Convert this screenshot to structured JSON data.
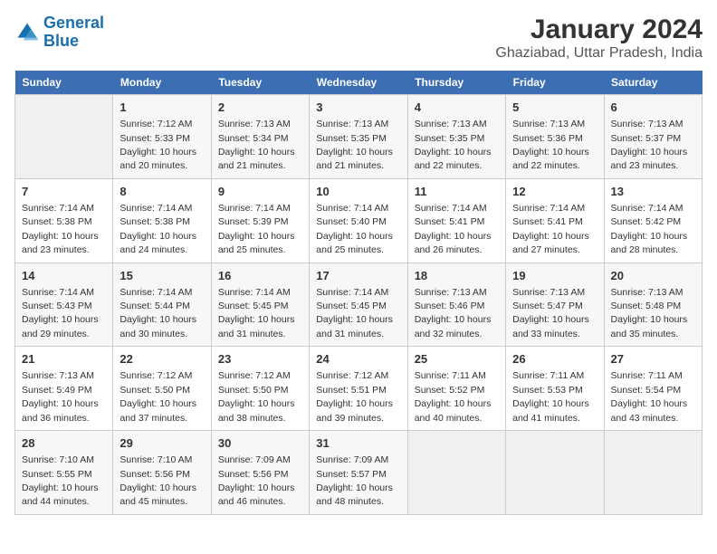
{
  "app": {
    "logo_line1": "General",
    "logo_line2": "Blue",
    "title": "January 2024",
    "subtitle": "Ghaziabad, Uttar Pradesh, India"
  },
  "calendar": {
    "headers": [
      "Sunday",
      "Monday",
      "Tuesday",
      "Wednesday",
      "Thursday",
      "Friday",
      "Saturday"
    ],
    "weeks": [
      [
        {
          "day": "",
          "info": ""
        },
        {
          "day": "1",
          "info": "Sunrise: 7:12 AM\nSunset: 5:33 PM\nDaylight: 10 hours\nand 20 minutes."
        },
        {
          "day": "2",
          "info": "Sunrise: 7:13 AM\nSunset: 5:34 PM\nDaylight: 10 hours\nand 21 minutes."
        },
        {
          "day": "3",
          "info": "Sunrise: 7:13 AM\nSunset: 5:35 PM\nDaylight: 10 hours\nand 21 minutes."
        },
        {
          "day": "4",
          "info": "Sunrise: 7:13 AM\nSunset: 5:35 PM\nDaylight: 10 hours\nand 22 minutes."
        },
        {
          "day": "5",
          "info": "Sunrise: 7:13 AM\nSunset: 5:36 PM\nDaylight: 10 hours\nand 22 minutes."
        },
        {
          "day": "6",
          "info": "Sunrise: 7:13 AM\nSunset: 5:37 PM\nDaylight: 10 hours\nand 23 minutes."
        }
      ],
      [
        {
          "day": "7",
          "info": "Sunrise: 7:14 AM\nSunset: 5:38 PM\nDaylight: 10 hours\nand 23 minutes."
        },
        {
          "day": "8",
          "info": "Sunrise: 7:14 AM\nSunset: 5:38 PM\nDaylight: 10 hours\nand 24 minutes."
        },
        {
          "day": "9",
          "info": "Sunrise: 7:14 AM\nSunset: 5:39 PM\nDaylight: 10 hours\nand 25 minutes."
        },
        {
          "day": "10",
          "info": "Sunrise: 7:14 AM\nSunset: 5:40 PM\nDaylight: 10 hours\nand 25 minutes."
        },
        {
          "day": "11",
          "info": "Sunrise: 7:14 AM\nSunset: 5:41 PM\nDaylight: 10 hours\nand 26 minutes."
        },
        {
          "day": "12",
          "info": "Sunrise: 7:14 AM\nSunset: 5:41 PM\nDaylight: 10 hours\nand 27 minutes."
        },
        {
          "day": "13",
          "info": "Sunrise: 7:14 AM\nSunset: 5:42 PM\nDaylight: 10 hours\nand 28 minutes."
        }
      ],
      [
        {
          "day": "14",
          "info": "Sunrise: 7:14 AM\nSunset: 5:43 PM\nDaylight: 10 hours\nand 29 minutes."
        },
        {
          "day": "15",
          "info": "Sunrise: 7:14 AM\nSunset: 5:44 PM\nDaylight: 10 hours\nand 30 minutes."
        },
        {
          "day": "16",
          "info": "Sunrise: 7:14 AM\nSunset: 5:45 PM\nDaylight: 10 hours\nand 31 minutes."
        },
        {
          "day": "17",
          "info": "Sunrise: 7:14 AM\nSunset: 5:45 PM\nDaylight: 10 hours\nand 31 minutes."
        },
        {
          "day": "18",
          "info": "Sunrise: 7:13 AM\nSunset: 5:46 PM\nDaylight: 10 hours\nand 32 minutes."
        },
        {
          "day": "19",
          "info": "Sunrise: 7:13 AM\nSunset: 5:47 PM\nDaylight: 10 hours\nand 33 minutes."
        },
        {
          "day": "20",
          "info": "Sunrise: 7:13 AM\nSunset: 5:48 PM\nDaylight: 10 hours\nand 35 minutes."
        }
      ],
      [
        {
          "day": "21",
          "info": "Sunrise: 7:13 AM\nSunset: 5:49 PM\nDaylight: 10 hours\nand 36 minutes."
        },
        {
          "day": "22",
          "info": "Sunrise: 7:12 AM\nSunset: 5:50 PM\nDaylight: 10 hours\nand 37 minutes."
        },
        {
          "day": "23",
          "info": "Sunrise: 7:12 AM\nSunset: 5:50 PM\nDaylight: 10 hours\nand 38 minutes."
        },
        {
          "day": "24",
          "info": "Sunrise: 7:12 AM\nSunset: 5:51 PM\nDaylight: 10 hours\nand 39 minutes."
        },
        {
          "day": "25",
          "info": "Sunrise: 7:11 AM\nSunset: 5:52 PM\nDaylight: 10 hours\nand 40 minutes."
        },
        {
          "day": "26",
          "info": "Sunrise: 7:11 AM\nSunset: 5:53 PM\nDaylight: 10 hours\nand 41 minutes."
        },
        {
          "day": "27",
          "info": "Sunrise: 7:11 AM\nSunset: 5:54 PM\nDaylight: 10 hours\nand 43 minutes."
        }
      ],
      [
        {
          "day": "28",
          "info": "Sunrise: 7:10 AM\nSunset: 5:55 PM\nDaylight: 10 hours\nand 44 minutes."
        },
        {
          "day": "29",
          "info": "Sunrise: 7:10 AM\nSunset: 5:56 PM\nDaylight: 10 hours\nand 45 minutes."
        },
        {
          "day": "30",
          "info": "Sunrise: 7:09 AM\nSunset: 5:56 PM\nDaylight: 10 hours\nand 46 minutes."
        },
        {
          "day": "31",
          "info": "Sunrise: 7:09 AM\nSunset: 5:57 PM\nDaylight: 10 hours\nand 48 minutes."
        },
        {
          "day": "",
          "info": ""
        },
        {
          "day": "",
          "info": ""
        },
        {
          "day": "",
          "info": ""
        }
      ]
    ]
  }
}
